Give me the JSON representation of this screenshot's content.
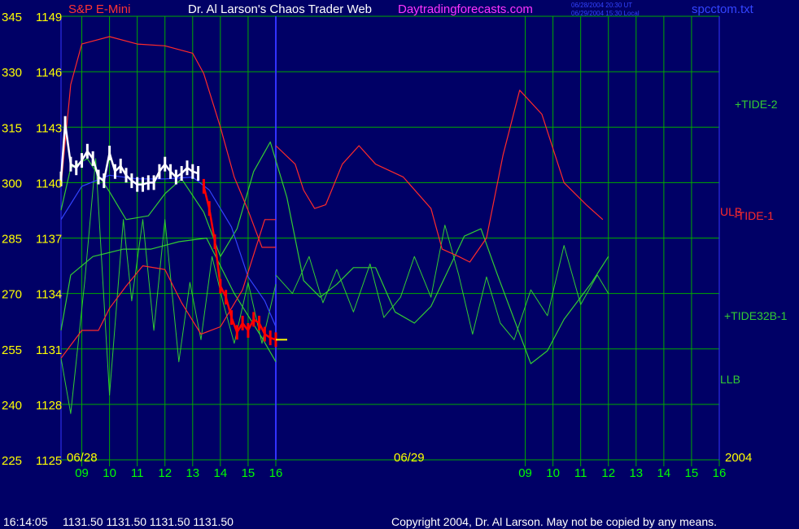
{
  "header": {
    "symbol": "S&P E-Mini",
    "title": "Dr. Al Larson's Chaos Trader Web",
    "site": "Daytradingforecasts.com",
    "stamp1": "06/28/2004 20:30 UT",
    "stamp2": "06/29/2004 15:30 Local",
    "file": "spcctom.txt"
  },
  "footer": {
    "time": "16:14:05",
    "quote": "1131.50 1131.50 1131.50 1131.50",
    "copyright": "Copyright 2004, Dr. Al Larson. May not be copied by any means."
  },
  "colors": {
    "background": "#000066",
    "grid": "#00aa00",
    "price_white": "#ffffff",
    "price_red": "#ff0000",
    "ulb": "#ff2a2a",
    "tide": "#33cc33",
    "blue_line": "#3344ff",
    "axis_text_yellow": "#ffff00",
    "axis_text_green": "#00ff00",
    "magenta": "#ff33ff",
    "divider": "#3333ff"
  },
  "chart_data": {
    "type": "line",
    "left_axis_outer": [
      "345",
      "330",
      "315",
      "300",
      "285",
      "270",
      "255",
      "240",
      "225"
    ],
    "left_axis_price": [
      "1149",
      "1146",
      "1143",
      "1140",
      "1137",
      "1134",
      "1131",
      "1128",
      "1125"
    ],
    "ylim_price": [
      1125,
      1149
    ],
    "x_ticks": [
      "09",
      "10",
      "11",
      "12",
      "13",
      "14",
      "15",
      "16",
      "09",
      "10",
      "11",
      "12",
      "13",
      "14",
      "15",
      "16"
    ],
    "x_hours": [
      9,
      10,
      11,
      12,
      13,
      14,
      15,
      16,
      25,
      26,
      27,
      28,
      29,
      30,
      31,
      32
    ],
    "xlim_hours": [
      8.25,
      32
    ],
    "date_labels": [
      "06/28",
      "06/29",
      "2004"
    ],
    "series_labels": [
      "+TIDE-2",
      "ULB",
      "-TIDE-1",
      "+TIDE32B-1",
      "LLB"
    ],
    "price_bars_white": [
      [
        8.25,
        1140.2
      ],
      [
        8.4,
        1143.2
      ],
      [
        8.6,
        1141
      ],
      [
        8.8,
        1140.8
      ],
      [
        9,
        1141.2
      ],
      [
        9.2,
        1141.7
      ],
      [
        9.4,
        1141.3
      ],
      [
        9.6,
        1140.3
      ],
      [
        9.8,
        1140.1
      ],
      [
        10,
        1141.6
      ],
      [
        10.2,
        1140.6
      ],
      [
        10.4,
        1140.9
      ],
      [
        10.6,
        1140.4
      ],
      [
        10.8,
        1140.1
      ],
      [
        11,
        1139.9
      ],
      [
        11.2,
        1139.9
      ],
      [
        11.4,
        1140
      ],
      [
        11.6,
        1140
      ],
      [
        11.8,
        1140.6
      ],
      [
        12,
        1141
      ],
      [
        12.2,
        1140.6
      ],
      [
        12.4,
        1140.3
      ],
      [
        12.6,
        1140.5
      ],
      [
        12.8,
        1140.8
      ],
      [
        13,
        1140.6
      ],
      [
        13.2,
        1140.5
      ]
    ],
    "price_bars_red": [
      [
        13.4,
        1139.8
      ],
      [
        13.6,
        1138.6
      ],
      [
        13.8,
        1136.8
      ],
      [
        14,
        1134.4
      ],
      [
        14.2,
        1133.8
      ],
      [
        14.4,
        1132.7
      ],
      [
        14.6,
        1131.9
      ],
      [
        14.8,
        1132.4
      ],
      [
        15,
        1132
      ],
      [
        15.2,
        1132.6
      ],
      [
        15.4,
        1132.4
      ],
      [
        15.6,
        1131.8
      ],
      [
        15.8,
        1131.6
      ],
      [
        16,
        1131.5
      ]
    ],
    "ulb_day1": [
      [
        8.25,
        1139.8
      ],
      [
        8.6,
        1145.3
      ],
      [
        9,
        1147.5
      ],
      [
        10,
        1147.9
      ],
      [
        11,
        1147.5
      ],
      [
        12,
        1147.4
      ],
      [
        13,
        1147
      ],
      [
        13.4,
        1145.9
      ],
      [
        14,
        1143
      ],
      [
        14.5,
        1140.3
      ],
      [
        15,
        1138.5
      ],
      [
        15.5,
        1136.5
      ],
      [
        16,
        1136.5
      ]
    ],
    "ulb_day2": [
      [
        16,
        1142
      ],
      [
        16.7,
        1141
      ],
      [
        17,
        1139.6
      ],
      [
        17.4,
        1138.6
      ],
      [
        17.8,
        1138.8
      ],
      [
        18.4,
        1141
      ],
      [
        19,
        1142
      ],
      [
        19.6,
        1141
      ],
      [
        20.6,
        1140.3
      ],
      [
        21.6,
        1138.6
      ],
      [
        22,
        1136.4
      ],
      [
        22.6,
        1136
      ],
      [
        23,
        1135.7
      ],
      [
        23.6,
        1137
      ],
      [
        24.2,
        1141.5
      ],
      [
        24.8,
        1145
      ],
      [
        25.6,
        1143.7
      ],
      [
        26.4,
        1140
      ],
      [
        27.2,
        1138.8
      ],
      [
        27.8,
        1138
      ]
    ],
    "lower_red": [
      [
        8.25,
        1130.5
      ],
      [
        9,
        1132
      ],
      [
        9.6,
        1132
      ],
      [
        10,
        1133.2
      ],
      [
        10.6,
        1134.4
      ],
      [
        11.2,
        1135.5
      ],
      [
        12,
        1135.3
      ],
      [
        12.6,
        1133.5
      ],
      [
        13.3,
        1131.8
      ],
      [
        14,
        1132.2
      ],
      [
        14.8,
        1134.2
      ],
      [
        15.6,
        1138
      ],
      [
        16,
        1138
      ]
    ],
    "tide2": [
      [
        8.25,
        1132
      ],
      [
        8.6,
        1135
      ],
      [
        9.4,
        1136
      ],
      [
        10.5,
        1136.4
      ],
      [
        11.5,
        1136.4
      ],
      [
        12.5,
        1136.8
      ],
      [
        13.5,
        1137
      ],
      [
        14.5,
        1134
      ],
      [
        15.5,
        1131.6
      ],
      [
        16,
        1130.3
      ]
    ],
    "tide1": [
      [
        8.25,
        1138.5
      ],
      [
        8.6,
        1140.8
      ],
      [
        9.2,
        1141.3
      ],
      [
        10,
        1139.5
      ],
      [
        10.6,
        1138
      ],
      [
        11.4,
        1138.2
      ],
      [
        12,
        1139.4
      ],
      [
        12.6,
        1140.2
      ],
      [
        13.4,
        1138.4
      ],
      [
        14,
        1136
      ],
      [
        14.6,
        1137.5
      ],
      [
        15.2,
        1140.6
      ],
      [
        15.8,
        1142.2
      ],
      [
        16.4,
        1139.2
      ],
      [
        17,
        1134.7
      ],
      [
        17.6,
        1133.8
      ],
      [
        18.2,
        1134.5
      ],
      [
        18.8,
        1135.4
      ],
      [
        19.6,
        1135.4
      ],
      [
        20.3,
        1133
      ],
      [
        21,
        1132.4
      ],
      [
        21.6,
        1133.3
      ],
      [
        22.2,
        1135.2
      ],
      [
        22.8,
        1137.1
      ],
      [
        23.4,
        1137.5
      ],
      [
        24,
        1135
      ],
      [
        24.6,
        1132.6
      ],
      [
        25.2,
        1130.2
      ],
      [
        25.8,
        1130.9
      ],
      [
        26.4,
        1132.6
      ],
      [
        27.4,
        1134.6
      ],
      [
        28,
        1136
      ]
    ],
    "blue": [
      [
        8.25,
        1138
      ],
      [
        9,
        1139.8
      ],
      [
        10,
        1140.4
      ],
      [
        11,
        1140.2
      ],
      [
        12,
        1140.2
      ],
      [
        13,
        1140.3
      ],
      [
        13.6,
        1139.6
      ],
      [
        14.4,
        1137.6
      ],
      [
        15,
        1134.9
      ],
      [
        15.6,
        1133.6
      ],
      [
        16,
        1132.2
      ]
    ],
    "tide32b_day1": [
      [
        8.25,
        1130.5
      ],
      [
        8.6,
        1127.5
      ],
      [
        9.1,
        1134.6
      ],
      [
        9.5,
        1141.3
      ],
      [
        10,
        1128.5
      ],
      [
        10.5,
        1138
      ],
      [
        10.8,
        1133.6
      ],
      [
        11.2,
        1138
      ],
      [
        11.6,
        1132
      ],
      [
        12,
        1138
      ],
      [
        12.5,
        1130.3
      ],
      [
        12.9,
        1134.6
      ],
      [
        13.3,
        1131.5
      ],
      [
        13.7,
        1136
      ],
      [
        14.1,
        1133.5
      ],
      [
        14.5,
        1131.3
      ],
      [
        15,
        1134.6
      ],
      [
        15.5,
        1131.3
      ],
      [
        16,
        1134.5
      ]
    ],
    "tide32b_day2": [
      [
        16,
        1135
      ],
      [
        16.6,
        1134
      ],
      [
        17.2,
        1136
      ],
      [
        17.7,
        1133.5
      ],
      [
        18.2,
        1135.3
      ],
      [
        18.8,
        1133
      ],
      [
        19.4,
        1135.6
      ],
      [
        19.9,
        1132.7
      ],
      [
        20.5,
        1133.8
      ],
      [
        21,
        1136
      ],
      [
        21.6,
        1133.8
      ],
      [
        22.1,
        1137.7
      ],
      [
        22.6,
        1135
      ],
      [
        23.1,
        1131.8
      ],
      [
        23.6,
        1134.9
      ],
      [
        24.1,
        1132.4
      ],
      [
        24.6,
        1131.5
      ],
      [
        25.2,
        1134.2
      ],
      [
        25.8,
        1132.8
      ],
      [
        26.4,
        1136.6
      ],
      [
        27,
        1133.4
      ],
      [
        27.6,
        1135
      ],
      [
        28,
        1134
      ]
    ]
  }
}
